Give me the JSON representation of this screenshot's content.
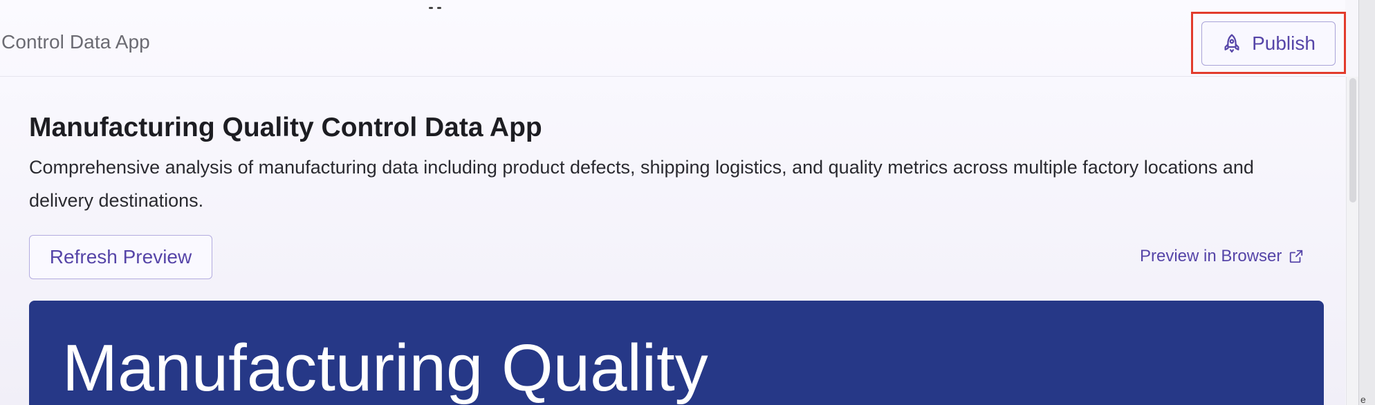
{
  "header": {
    "breadcrumb": "Control Data App",
    "publish_label": "Publish"
  },
  "app": {
    "title": "Manufacturing Quality Control Data App",
    "description": "Comprehensive analysis of manufacturing data including product defects, shipping logistics, and quality metrics across multiple factory locations and delivery destinations.",
    "refresh_label": "Refresh Preview",
    "preview_link_label": "Preview in Browser"
  },
  "preview": {
    "hero_title": "Manufacturing Quality"
  },
  "colors": {
    "accent": "#5645a8",
    "highlight": "#e23b2c",
    "hero_bg": "#263887"
  },
  "icons": {
    "publish": "rocket-icon",
    "preview": "external-link-icon"
  }
}
